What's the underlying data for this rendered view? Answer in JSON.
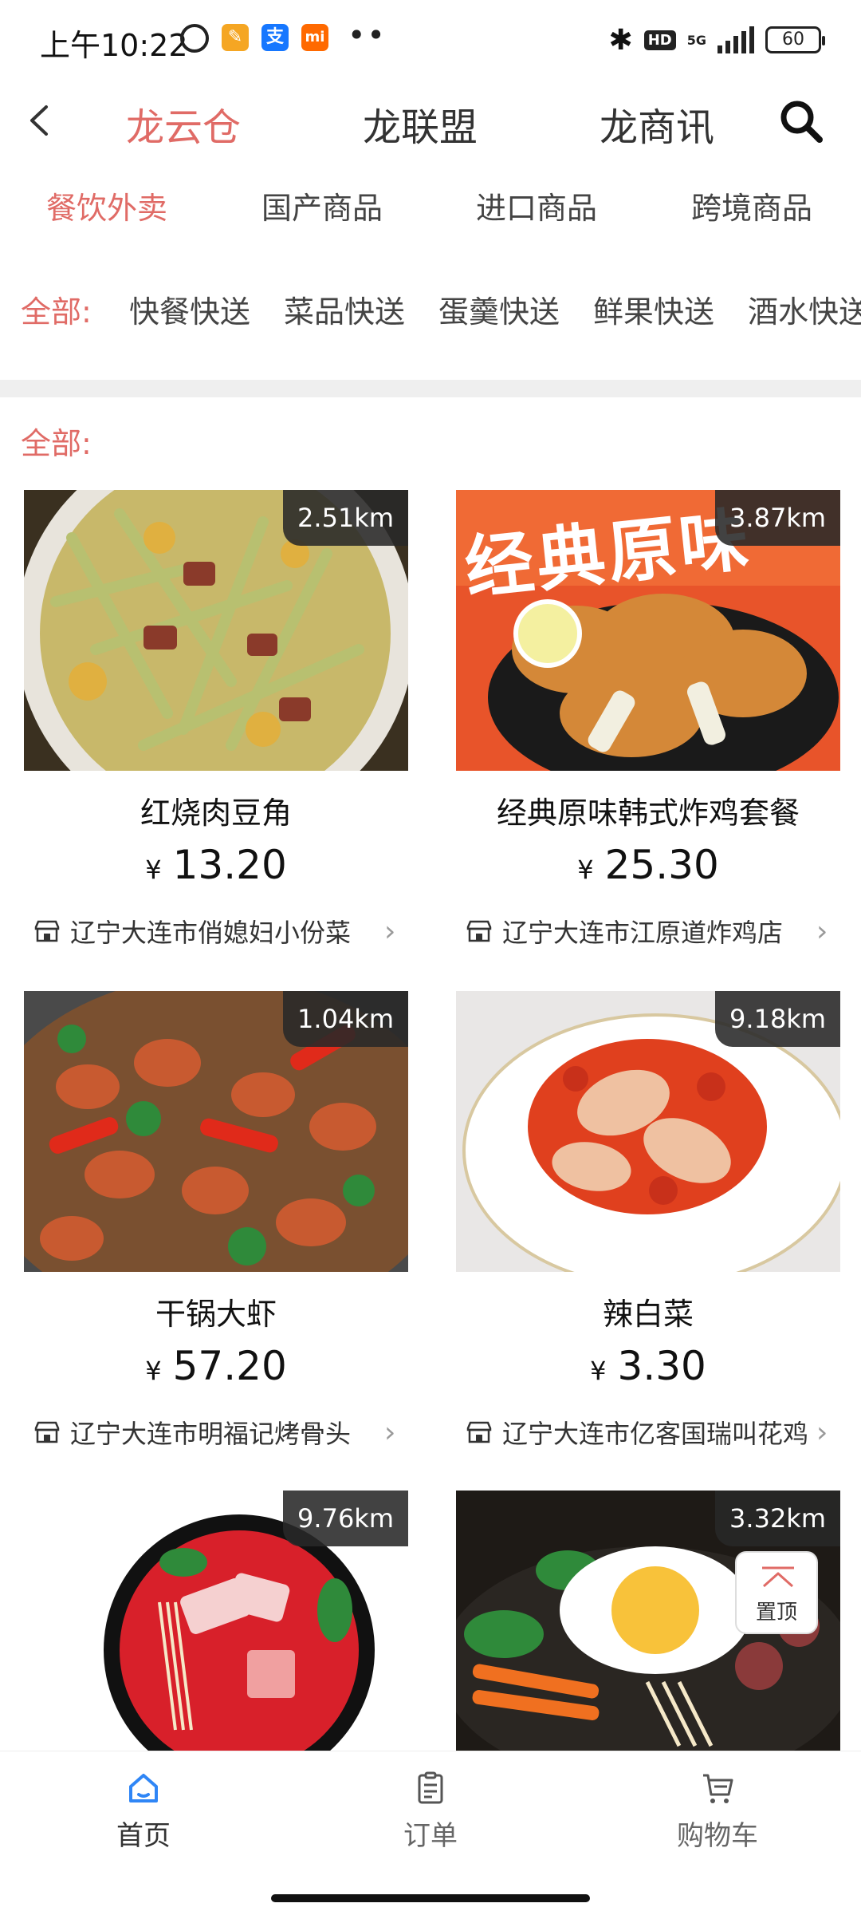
{
  "status_bar": {
    "time": "上午10:22",
    "battery": "60",
    "network": "5G",
    "hd": "HD",
    "app_icons": [
      {
        "name": "notes-icon",
        "color": "#f5a623",
        "glyph": "✎"
      },
      {
        "name": "alipay-icon",
        "color": "#1677ff",
        "glyph": "支"
      },
      {
        "name": "mi-icon",
        "color": "#ff6900",
        "glyph": "mi"
      }
    ],
    "more_dots": "••"
  },
  "top_nav": {
    "tabs": [
      {
        "label": "龙云仓",
        "active": true
      },
      {
        "label": "龙联盟",
        "active": false
      },
      {
        "label": "龙商讯",
        "active": false
      }
    ]
  },
  "categories": [
    {
      "label": "餐饮外卖",
      "active": true
    },
    {
      "label": "国产商品",
      "active": false
    },
    {
      "label": "进口商品",
      "active": false
    },
    {
      "label": "跨境商品",
      "active": false
    }
  ],
  "sub_categories": {
    "label": "全部:",
    "items": [
      "快餐快送",
      "菜品快送",
      "蛋羹快送",
      "鲜果快送",
      "酒水快送"
    ]
  },
  "section_label": "全部:",
  "products": [
    {
      "name": "红烧肉豆角",
      "price": "13.20",
      "currency": "¥",
      "distance": "2.51km",
      "shop": "辽宁大连市俏媳妇小份菜"
    },
    {
      "name": "经典原味韩式炸鸡套餐",
      "price": "25.30",
      "currency": "¥",
      "distance": "3.87km",
      "shop": "辽宁大连市江原道炸鸡店",
      "banner_text": "经典原味"
    },
    {
      "name": "干锅大虾",
      "price": "57.20",
      "currency": "¥",
      "distance": "1.04km",
      "shop": "辽宁大连市明福记烤骨头"
    },
    {
      "name": "辣白菜",
      "price": "3.30",
      "currency": "¥",
      "distance": "9.18km",
      "shop": "辽宁大连市亿客国瑞叫花鸡"
    },
    {
      "name": "",
      "price": "",
      "currency": "",
      "distance": "9.76km",
      "shop": ""
    },
    {
      "name": "",
      "price": "",
      "currency": "",
      "distance": "3.32km",
      "shop": ""
    }
  ],
  "scroll_top": {
    "label": "置顶"
  },
  "bottom_nav": [
    {
      "label": "首页",
      "icon": "home-icon",
      "active": true
    },
    {
      "label": "订单",
      "icon": "order-icon",
      "active": false
    },
    {
      "label": "购物车",
      "icon": "cart-icon",
      "active": false
    }
  ],
  "colors": {
    "accent": "#e06b66",
    "home_active": "#2f86f6"
  }
}
